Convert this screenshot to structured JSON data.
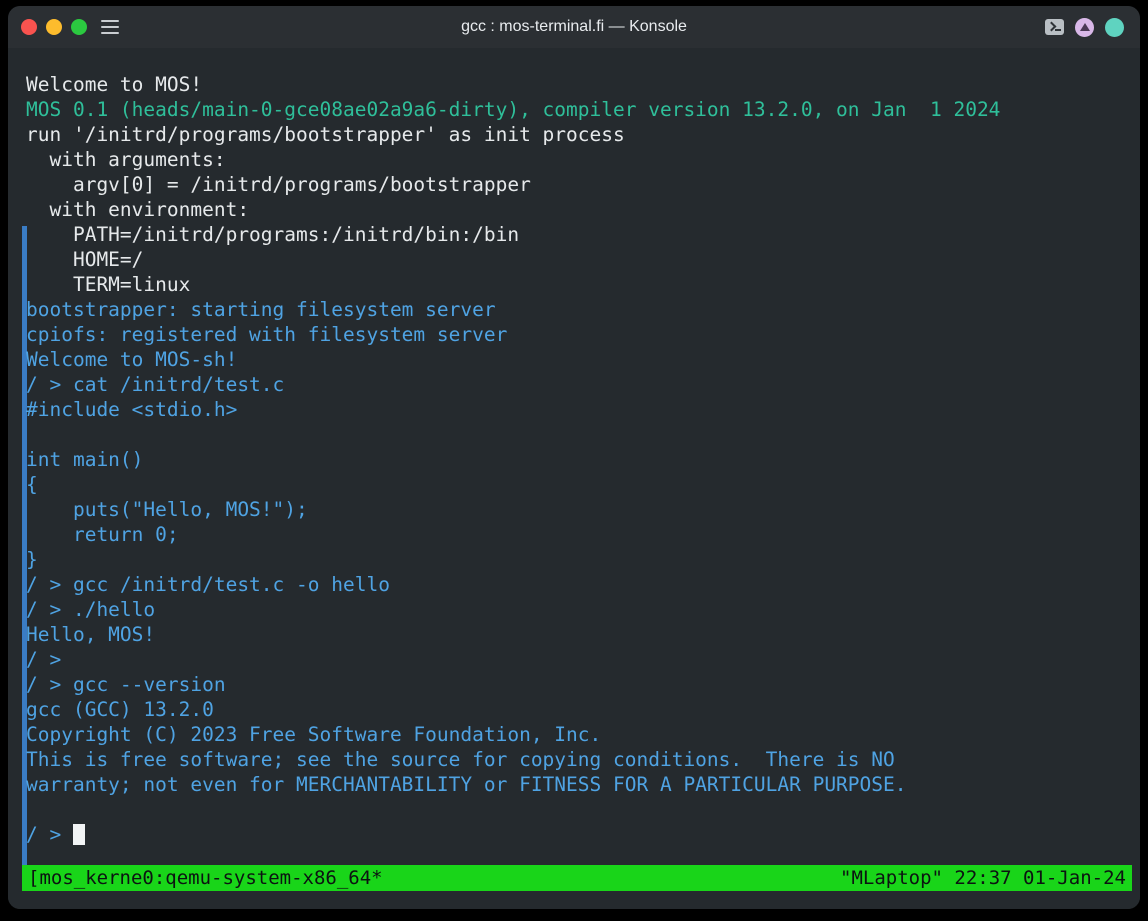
{
  "window": {
    "title": "gcc : mos-terminal.fi — Konsole",
    "controls": {
      "close_label": "Close",
      "minimize_label": "Minimize",
      "maximize_label": "Maximize",
      "menu_label": "Menu"
    },
    "right_icons": [
      {
        "name": "terminal-icon",
        "label": "Terminal"
      },
      {
        "name": "notification-icon",
        "label": "Notifications"
      },
      {
        "name": "status-indicator-icon",
        "label": "Status"
      }
    ],
    "colors": {
      "titlebar_bg": "#2b2f33",
      "terminal_bg": "#252a2e",
      "close": "#f9534f",
      "minimize": "#fdbc2d",
      "maximize": "#2bc940",
      "scrollbar": "#3a7cc4",
      "statusbar_bg": "#19d519",
      "text_white": "#e6e9eb",
      "text_green": "#2fbf9a",
      "text_blue": "#4fa3e3"
    }
  },
  "terminal": {
    "lines": [
      {
        "text": "Welcome to MOS!",
        "color": "c-white"
      },
      {
        "text": "MOS 0.1 (heads/main-0-gce08ae02a9a6-dirty), compiler version 13.2.0, on Jan  1 2024",
        "color": "c-green"
      },
      {
        "text": "run '/initrd/programs/bootstrapper' as init process",
        "color": "c-white"
      },
      {
        "text": "  with arguments:",
        "color": "c-white"
      },
      {
        "text": "    argv[0] = /initrd/programs/bootstrapper",
        "color": "c-white"
      },
      {
        "text": "  with environment:",
        "color": "c-white"
      },
      {
        "text": "    PATH=/initrd/programs:/initrd/bin:/bin",
        "color": "c-white"
      },
      {
        "text": "    HOME=/",
        "color": "c-white"
      },
      {
        "text": "    TERM=linux",
        "color": "c-white"
      },
      {
        "text": "bootstrapper: starting filesystem server",
        "color": "c-blue"
      },
      {
        "text": "cpiofs: registered with filesystem server",
        "color": "c-blue"
      },
      {
        "text": "Welcome to MOS-sh!",
        "color": "c-blue"
      },
      {
        "text": "/ > cat /initrd/test.c",
        "color": "c-blue"
      },
      {
        "text": "#include <stdio.h>",
        "color": "c-blue"
      },
      {
        "text": "",
        "color": "c-blue"
      },
      {
        "text": "int main()",
        "color": "c-blue"
      },
      {
        "text": "{",
        "color": "c-blue"
      },
      {
        "text": "    puts(\"Hello, MOS!\");",
        "color": "c-blue"
      },
      {
        "text": "    return 0;",
        "color": "c-blue"
      },
      {
        "text": "}",
        "color": "c-blue"
      },
      {
        "text": "/ > gcc /initrd/test.c -o hello",
        "color": "c-blue"
      },
      {
        "text": "/ > ./hello",
        "color": "c-blue"
      },
      {
        "text": "Hello, MOS!",
        "color": "c-blue"
      },
      {
        "text": "/ > ",
        "color": "c-blue"
      },
      {
        "text": "/ > gcc --version",
        "color": "c-blue"
      },
      {
        "text": "gcc (GCC) 13.2.0",
        "color": "c-blue"
      },
      {
        "text": "Copyright (C) 2023 Free Software Foundation, Inc.",
        "color": "c-blue"
      },
      {
        "text": "This is free software; see the source for copying conditions.  There is NO",
        "color": "c-blue"
      },
      {
        "text": "warranty; not even for MERCHANTABILITY or FITNESS FOR A PARTICULAR PURPOSE.",
        "color": "c-blue"
      },
      {
        "text": "",
        "color": "c-blue"
      }
    ],
    "prompt": "/ > ",
    "cursor_visible": true
  },
  "statusbar": {
    "left": "[mos_kerne0:qemu-system-x86_64*",
    "right": "\"MLaptop\" 22:37 01-Jan-24"
  }
}
